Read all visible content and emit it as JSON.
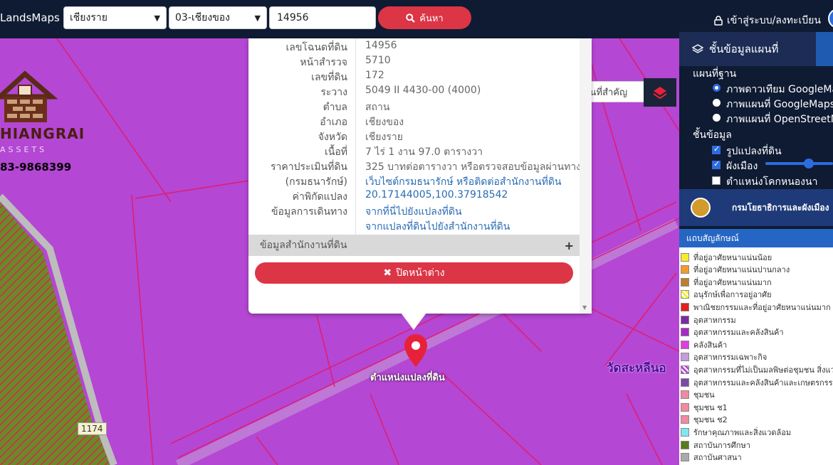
{
  "topbar": {
    "brand": "LandsMaps",
    "province": "เชียงราย",
    "district": "03-เชียงของ",
    "plot_number": "14956",
    "search_label": "ค้นหา",
    "login_label": "เข้าสู่ระบบ/ลงทะเบียน"
  },
  "map": {
    "logo_name": "HIANGRAI",
    "logo_sub": "ASSETS",
    "logo_phone": "83-9868399",
    "temple_label": "วัดสะหลีนอ",
    "pin_label": "ตำแหน่งแปลงที่ดิน",
    "road_number": "1174",
    "place_search_placeholder": "ค้นหาสถานที่สำคัญ",
    "zone_color": "#b447d3",
    "boundary_color": "#e21b6b"
  },
  "popup": {
    "rows": [
      {
        "label": "เลขโฉนดที่ดิน",
        "value": "14956",
        "link": false
      },
      {
        "label": "หน้าสำรวจ",
        "value": "5710",
        "link": false
      },
      {
        "label": "เลขที่ดิน",
        "value": "172",
        "link": false
      },
      {
        "label": "ระวาง",
        "value": "5049 II 4430-00 (4000)",
        "link": false
      },
      {
        "label": "ตำบล",
        "value": "สถาน",
        "link": false
      },
      {
        "label": "อำเภอ",
        "value": "เชียงของ",
        "link": false
      },
      {
        "label": "จังหวัด",
        "value": "เชียงราย",
        "link": false
      },
      {
        "label": "เนื้อที่",
        "value": "7 ไร่ 1 งาน 97.0 ตารางวา",
        "link": false
      },
      {
        "label": "ราคาประเมินที่ดิน",
        "value": "325 บาทต่อตารางวา หรือตรวจสอบข้อมูลผ่านทาง",
        "link": false
      },
      {
        "label": "(กรมธนารักษ์)",
        "value": "เว็บไซต์กรมธนารักษ์ หรือติดต่อสำนักงานที่ดิน",
        "link": true
      },
      {
        "label": "ค่าพิกัดแปลง",
        "value": "20.17144005,100.37918542",
        "link": true
      },
      {
        "label": "ข้อมูลการเดินทาง",
        "value": "จากที่นี่ไปยังแปลงที่ดิน",
        "link": true
      },
      {
        "label": "",
        "value": "จากแปลงที่ดินไปยังสำนักงานที่ดิน",
        "link": true
      }
    ],
    "office_section": "ข้อมูลสำนักงานที่ดิน",
    "close_label": "ปิดหน้าต่าง"
  },
  "right_panel": {
    "header": "ชั้นข้อมูลแผนที่",
    "base_title": "แผนที่ฐาน",
    "base_options": [
      {
        "label": "ภาพดาวเทียม GoogleMa",
        "selected": true
      },
      {
        "label": "ภาพแผนที่ GoogleMaps",
        "selected": false
      },
      {
        "label": "ภาพแผนที่ OpenStreetM",
        "selected": false
      }
    ],
    "layer_title": "ชั้นข้อมูล",
    "layers": [
      {
        "label": "รูปแปลงที่ดิน",
        "checked": true
      },
      {
        "label": "ผังเมือง",
        "checked": true
      },
      {
        "label": "ตำแหน่งโคกหนองนา",
        "checked": false
      }
    ],
    "opacity_fraction": 0.6,
    "department": "กรมโยธาธิการและผังเมือง",
    "legend_title": "แถบสัญลักษณ์",
    "legend": [
      {
        "label": "ที่อยู่อาศัยหนาแน่นน้อย",
        "color": "#f6ec2c"
      },
      {
        "label": "ที่อยู่อาศัยหนาแน่นปานกลาง",
        "color": "#f39a2c"
      },
      {
        "label": "ที่อยู่อาศัยหนาแน่นมาก",
        "color": "#b9812c"
      },
      {
        "label": "อนุรักษ์เพื่อการอยู่อาศัย",
        "color": "#f6ec2c"
      },
      {
        "label": "พาณิชยกรรมและที่อยู่อาศัยหนาแน่นมาก",
        "color": "#e0221e"
      },
      {
        "label": "อุตสาหกรรม",
        "color": "#7b2aa6"
      },
      {
        "label": "อุตสาหกรรมและคลังสินค้า",
        "color": "#a52ac8"
      },
      {
        "label": "คลังสินค้า",
        "color": "#e03ee0"
      },
      {
        "label": "อุตสาหกรรมเฉพาะกิจ",
        "color": "#c79ae0"
      },
      {
        "label": "อุตสาหกรรมที่ไม่เป็นมลพิษต่อชุมชน สิ่งแวด",
        "color": "#b447d3"
      },
      {
        "label": "อุตสาหกรรมและคลังสินค้าและเกษตรกรรม",
        "color": "#7b4aa6"
      },
      {
        "label": "ชุมชน",
        "color": "#f08aa0"
      },
      {
        "label": "ชุมชน ช1",
        "color": "#f08aa0"
      },
      {
        "label": "ชุมชน ช2",
        "color": "#f08aa0"
      },
      {
        "label": "รักษาคุณภาพและสิ่งแวดล้อม",
        "color": "#7ee8f0"
      },
      {
        "label": "สถาบันการศึกษา",
        "color": "#5a7a1c"
      },
      {
        "label": "สถาบันศาสนา",
        "color": "#aaaaaa"
      }
    ]
  }
}
